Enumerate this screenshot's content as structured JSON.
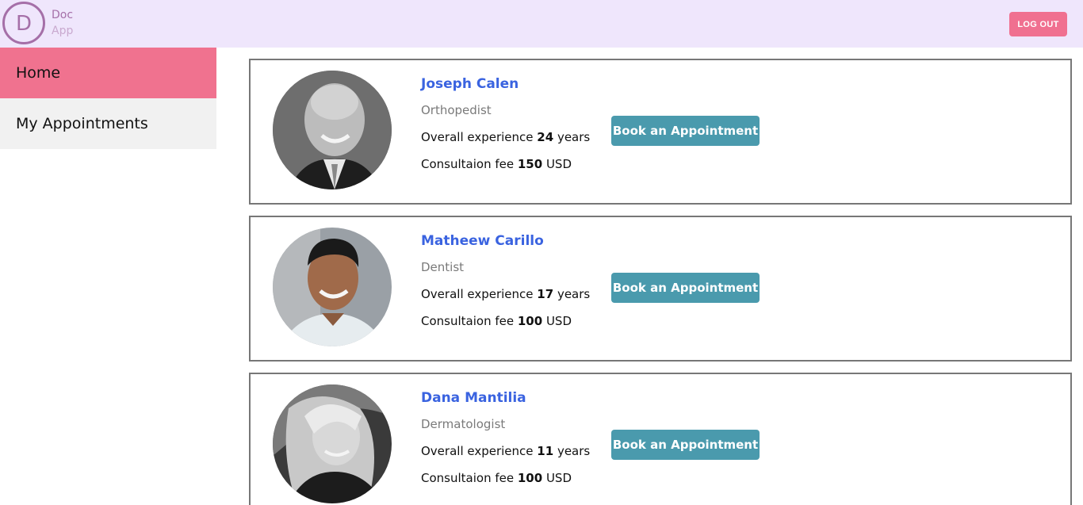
{
  "app": {
    "logo_letter": "D",
    "logo_word1": "Doc",
    "logo_word2": "App",
    "logout_label": "LOG OUT"
  },
  "sidebar": {
    "items": [
      {
        "label": "Home",
        "active": true
      },
      {
        "label": "My Appointments",
        "active": false
      }
    ]
  },
  "doctors": [
    {
      "name": "Joseph Calen",
      "specialty": "Orthopedist",
      "exp_prefix": "Overall experience",
      "exp_value": "24",
      "exp_suffix": "years",
      "fee_prefix": "Consultaion fee",
      "fee_value": "150",
      "fee_suffix": "USD",
      "button_label": "Book an Appointment",
      "photo_icon": "doctor-photo"
    },
    {
      "name": "Matheew Carillo",
      "specialty": "Dentist",
      "exp_prefix": "Overall experience",
      "exp_value": "17",
      "exp_suffix": "years",
      "fee_prefix": "Consultaion fee",
      "fee_value": "100",
      "fee_suffix": "USD",
      "button_label": "Book an Appointment",
      "photo_icon": "doctor-photo"
    },
    {
      "name": "Dana Mantilia",
      "specialty": "Dermatologist",
      "exp_prefix": "Overall experience",
      "exp_value": "11",
      "exp_suffix": "years",
      "fee_prefix": "Consultaion fee",
      "fee_value": "100",
      "fee_suffix": "USD",
      "button_label": "Book an Appointment",
      "photo_icon": "doctor-photo"
    }
  ],
  "colors": {
    "topbar_bg": "#efe6fc",
    "accent_pink": "#f0728f",
    "link_blue": "#3a63e0",
    "button_teal": "#4a9aad"
  }
}
